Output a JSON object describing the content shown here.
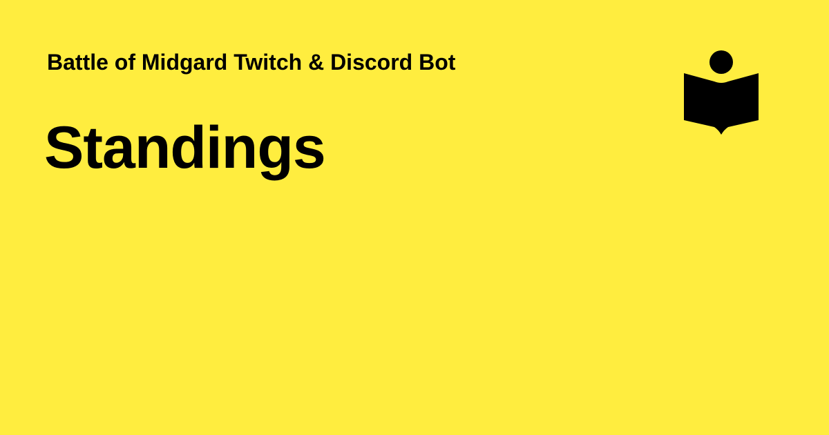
{
  "card": {
    "background_color": "#FFED3F",
    "text_color": "#000000",
    "site_title": "Battle of Midgard Twitch & Discord Bot",
    "page_title": "Standings",
    "logo_icon": "reader-book-icon"
  }
}
